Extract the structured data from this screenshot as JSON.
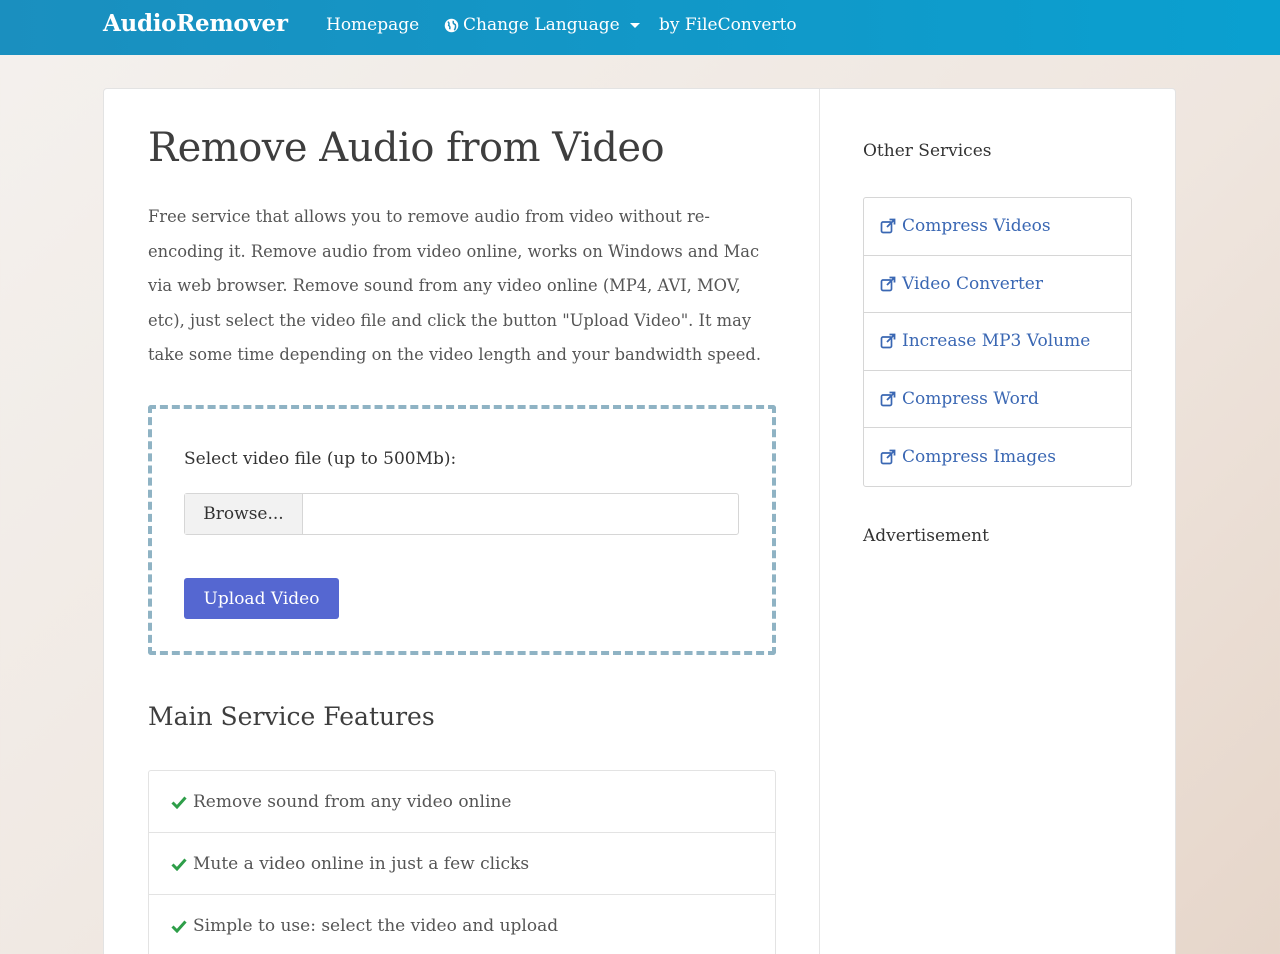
{
  "nav": {
    "brand": "AudioRemover",
    "home": "Homepage",
    "language": "Change Language",
    "by": "by FileConverto"
  },
  "main": {
    "title": "Remove Audio from Video",
    "intro": "Free service that allows you to remove audio from video without re-encoding it. Remove audio from video online, works on Windows and Mac via web browser. Remove sound from any video online (MP4, AVI, MOV, etc), just select the video file and click the button \"Upload Video\". It may take some time depending on the video length and your bandwidth speed.",
    "select_label": "Select video file (up to 500Mb):",
    "browse_label": "Browse...",
    "upload_label": "Upload Video",
    "features_title": "Main Service Features",
    "features": [
      "Remove sound from any video online",
      "Mute a video online in just a few clicks",
      "Simple to use: select the video and upload"
    ]
  },
  "sidebar": {
    "title": "Other Services",
    "services": [
      "Compress Videos",
      "Video Converter",
      "Increase MP3 Volume",
      "Compress Word",
      "Compress Images"
    ],
    "ad_title": "Advertisement"
  },
  "colors": {
    "navbar": "#0aa0d0",
    "accent_button": "#5567d1",
    "link": "#3a67b3",
    "check": "#2e9e49"
  }
}
